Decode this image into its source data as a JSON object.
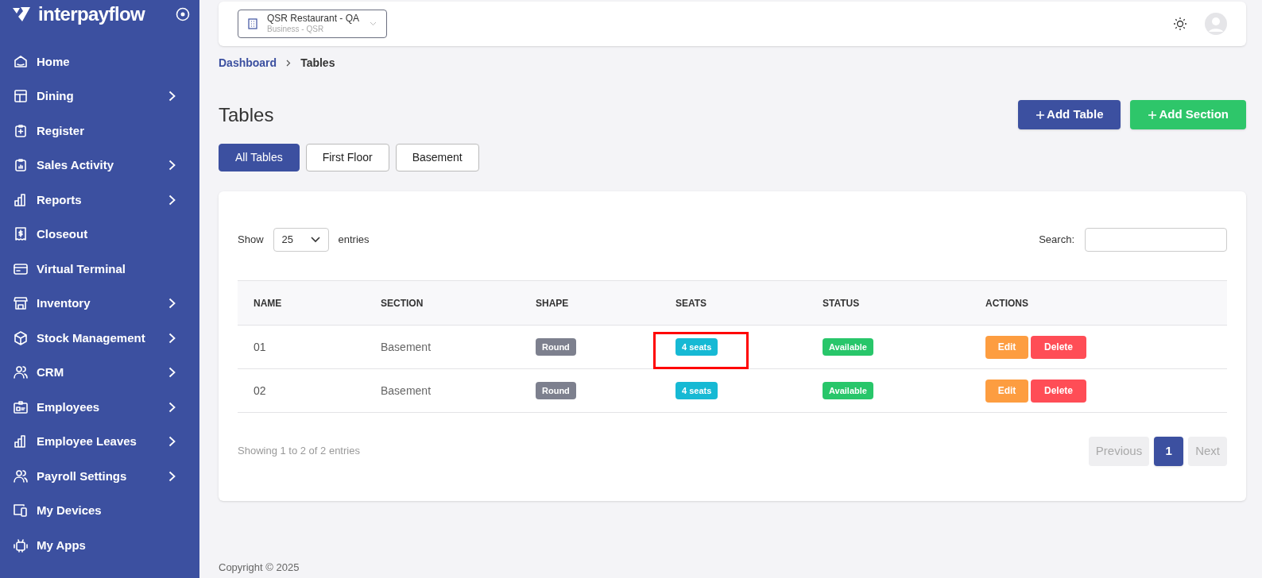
{
  "sidebar": {
    "logo": "interpayflow",
    "items": [
      {
        "label": "Home",
        "expandable": false
      },
      {
        "label": "Dining",
        "expandable": true
      },
      {
        "label": "Register",
        "expandable": false
      },
      {
        "label": "Sales Activity",
        "expandable": true
      },
      {
        "label": "Reports",
        "expandable": true
      },
      {
        "label": "Closeout",
        "expandable": false
      },
      {
        "label": "Virtual Terminal",
        "expandable": false
      },
      {
        "label": "Inventory",
        "expandable": true
      },
      {
        "label": "Stock Management",
        "expandable": true
      },
      {
        "label": "CRM",
        "expandable": true
      },
      {
        "label": "Employees",
        "expandable": true
      },
      {
        "label": "Employee Leaves",
        "expandable": true
      },
      {
        "label": "Payroll Settings",
        "expandable": true
      },
      {
        "label": "My Devices",
        "expandable": false
      },
      {
        "label": "My Apps",
        "expandable": false
      }
    ]
  },
  "business_selector": {
    "name": "QSR Restaurant - QA",
    "subtitle": "Business - QSR"
  },
  "breadcrumb": [
    {
      "label": "Dashboard"
    },
    {
      "label": "Tables"
    }
  ],
  "page_title": "Tables",
  "actions": [
    {
      "label": "Add Table",
      "kind": "primary"
    },
    {
      "label": "Add Section",
      "kind": "success"
    }
  ],
  "tabs": [
    {
      "label": "All Tables",
      "selected": true
    },
    {
      "label": "First Floor",
      "selected": false
    },
    {
      "label": "Basement",
      "selected": false
    }
  ],
  "table_controls": {
    "show_label": "Show",
    "page_size": "25",
    "entries_label": "entries",
    "search_label": "Search:"
  },
  "table": {
    "columns": [
      "NAME",
      "SECTION",
      "SHAPE",
      "SEATS",
      "STATUS",
      "ACTIONS"
    ],
    "rows": [
      {
        "name": "01",
        "section": "Basement",
        "shape": "Round",
        "seats": "4 seats",
        "status": "Available",
        "actions": [
          "Edit",
          "Delete"
        ],
        "seats_highlighted": true
      },
      {
        "name": "02",
        "section": "Basement",
        "shape": "Round",
        "seats": "4 seats",
        "status": "Available",
        "actions": [
          "Edit",
          "Delete"
        ],
        "seats_highlighted": false
      }
    ]
  },
  "footer_info": "Showing 1 to 2 of 2 entries",
  "pagination": [
    {
      "label": "Previous",
      "kind": "nav",
      "selected": false
    },
    {
      "label": "1",
      "kind": "page",
      "selected": true
    },
    {
      "label": "Next",
      "kind": "nav",
      "selected": false
    }
  ],
  "copyright": "Copyright © 2025"
}
